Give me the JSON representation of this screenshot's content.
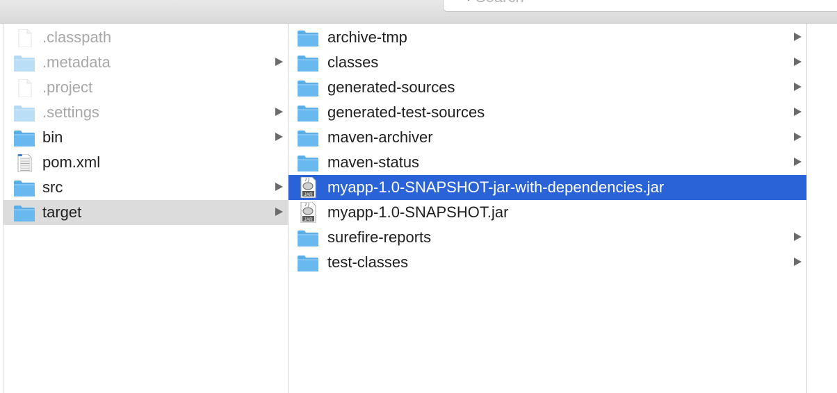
{
  "search": {
    "placeholder": "Search"
  },
  "columns": [
    {
      "items": [
        {
          "name": ".classpath",
          "type": "file",
          "hidden": true,
          "has_children": false
        },
        {
          "name": ".metadata",
          "type": "folder",
          "hidden": true,
          "has_children": true
        },
        {
          "name": ".project",
          "type": "file",
          "hidden": true,
          "has_children": false
        },
        {
          "name": ".settings",
          "type": "folder",
          "hidden": true,
          "has_children": true
        },
        {
          "name": "bin",
          "type": "folder",
          "hidden": false,
          "has_children": true
        },
        {
          "name": "pom.xml",
          "type": "xml-file",
          "hidden": false,
          "has_children": false
        },
        {
          "name": "src",
          "type": "folder",
          "hidden": false,
          "has_children": true
        },
        {
          "name": "target",
          "type": "folder",
          "hidden": false,
          "has_children": true,
          "selected": "inactive"
        }
      ]
    },
    {
      "items": [
        {
          "name": "archive-tmp",
          "type": "folder",
          "has_children": true
        },
        {
          "name": "classes",
          "type": "folder",
          "has_children": true
        },
        {
          "name": "generated-sources",
          "type": "folder",
          "has_children": true
        },
        {
          "name": "generated-test-sources",
          "type": "folder",
          "has_children": true
        },
        {
          "name": "maven-archiver",
          "type": "folder",
          "has_children": true
        },
        {
          "name": "maven-status",
          "type": "folder",
          "has_children": true
        },
        {
          "name": "myapp-1.0-SNAPSHOT-jar-with-dependencies.jar",
          "type": "jar",
          "has_children": false,
          "selected": "active"
        },
        {
          "name": "myapp-1.0-SNAPSHOT.jar",
          "type": "jar",
          "has_children": false
        },
        {
          "name": "surefire-reports",
          "type": "folder",
          "has_children": true
        },
        {
          "name": "test-classes",
          "type": "folder",
          "has_children": true
        }
      ]
    }
  ],
  "icons": {
    "jar_label": "JAR"
  },
  "colors": {
    "selection_active": "#2a63d8",
    "selection_inactive": "#dcdcdc",
    "folder": "#69b8ee"
  }
}
